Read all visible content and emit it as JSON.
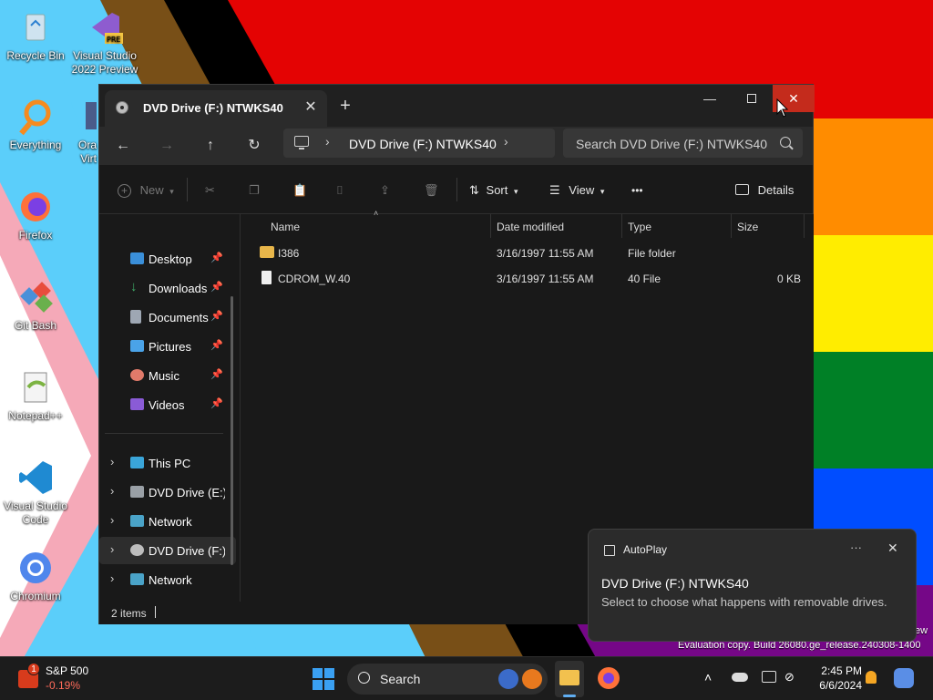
{
  "desktop": {
    "icons": [
      {
        "label": "Recycle Bin"
      },
      {
        "label": "Visual Studio 2022 Preview"
      },
      {
        "label": "Everything"
      },
      {
        "label": "Ora Virt"
      },
      {
        "label": "Firefox"
      },
      {
        "label": "Git Bash"
      },
      {
        "label": "Notepad++"
      },
      {
        "label": "Visual Studio Code"
      },
      {
        "label": "Chromium"
      }
    ],
    "watermark_line1": "ew",
    "watermark_line2": "Evaluation copy. Build 26080.ge_release.240308-1400"
  },
  "window": {
    "tab_title": "DVD Drive (F:) NTWKS40",
    "new_tab": "+",
    "address_crumb": "DVD Drive (F:) NTWKS40",
    "search_placeholder": "Search DVD Drive (F:) NTWKS40",
    "toolbar": {
      "new_label": "New",
      "sort_label": "Sort",
      "view_label": "View",
      "more_label": "•••",
      "details_label": "Details"
    },
    "nav": {
      "pinned": [
        {
          "label": "Desktop",
          "icon": "desktop-icon",
          "color": "#3a8fd9"
        },
        {
          "label": "Downloads",
          "icon": "download-icon",
          "color": "#3fae6a"
        },
        {
          "label": "Documents",
          "icon": "document-icon",
          "color": "#9ea7b3"
        },
        {
          "label": "Pictures",
          "icon": "picture-icon",
          "color": "#4aa3e8"
        },
        {
          "label": "Music",
          "icon": "music-icon",
          "color": "#e07a6a"
        },
        {
          "label": "Videos",
          "icon": "video-icon",
          "color": "#8a5bd6"
        }
      ],
      "tree": [
        {
          "label": "This PC",
          "icon": "pc-icon",
          "color": "#3aa5d9"
        },
        {
          "label": "DVD Drive (E:) L",
          "icon": "dvd-icon",
          "color": "#9aa0a6"
        },
        {
          "label": "Network",
          "icon": "network-icon",
          "color": "#4aa3c8"
        },
        {
          "label": "DVD Drive (F:) N",
          "icon": "dvd-icon",
          "color": "#bdbdbd"
        },
        {
          "label": "Network",
          "icon": "network-icon",
          "color": "#4aa3c8"
        }
      ]
    },
    "columns": {
      "name": "Name",
      "date": "Date modified",
      "type": "Type",
      "size": "Size"
    },
    "files": [
      {
        "name": "I386",
        "date": "3/16/1997 11:55 AM",
        "type": "File folder",
        "size": "",
        "icon": "folder-icon"
      },
      {
        "name": "CDROM_W.40",
        "date": "3/16/1997 11:55 AM",
        "type": "40 File",
        "size": "0 KB",
        "icon": "file-icon"
      }
    ],
    "status": "2 items"
  },
  "toast": {
    "app": "AutoPlay",
    "title": "DVD Drive (F:) NTWKS40",
    "body": "Select to choose what happens with removable drives.",
    "more": "···"
  },
  "taskbar": {
    "stock_name": "S&P 500",
    "stock_change": "-0.19%",
    "stock_badge": "1",
    "search_label": "Search",
    "time": "2:45 PM",
    "date": "6/6/2024"
  }
}
